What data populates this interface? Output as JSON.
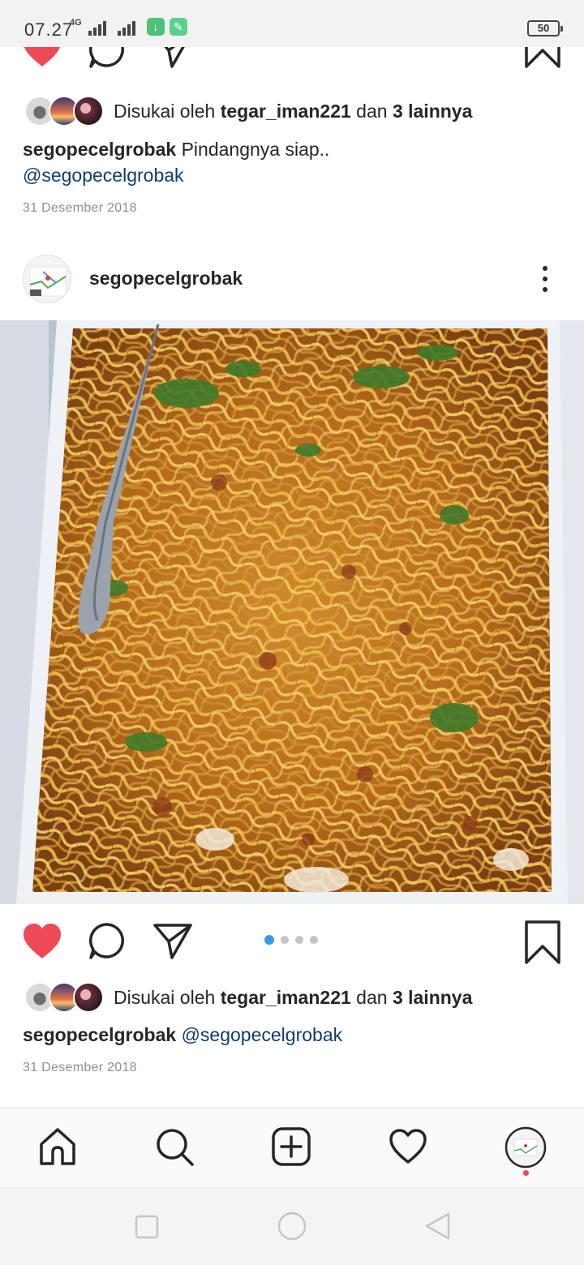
{
  "status_bar": {
    "time": "07.27",
    "network": "4G",
    "battery": "50"
  },
  "post1": {
    "likes_prefix": "Disukai oleh ",
    "likes_user": "tegar_iman221",
    "likes_and": " dan ",
    "likes_others": "3 lainnya",
    "caption_user": "segopecelgrobak",
    "caption_text": " Pindangnya siap..",
    "caption_mention": "@segopecelgrobak",
    "date": "31 Desember 2018"
  },
  "post2": {
    "username": "segopecelgrobak",
    "carousel_count": 4,
    "carousel_active": 1,
    "likes_prefix": "Disukai oleh ",
    "likes_user": "tegar_iman221",
    "likes_and": " dan ",
    "likes_others": "3 lainnya",
    "caption_user": "segopecelgrobak",
    "caption_mention": "@segopecelgrobak",
    "date": "31 Desember 2018"
  },
  "icons": {
    "like": "heart-filled-icon",
    "comment": "comment-bubble-icon",
    "share": "paper-plane-icon",
    "save": "bookmark-icon",
    "more": "vertical-dots-icon",
    "nav": [
      "home-icon",
      "search-icon",
      "add-post-icon",
      "activity-heart-icon",
      "profile-avatar-icon"
    ],
    "system": [
      "recent-apps-icon",
      "home-circle-icon",
      "back-triangle-icon"
    ]
  },
  "colors": {
    "like_red": "#ed4956",
    "mention_blue": "#0f3c6e",
    "carousel_active": "#3897f0",
    "notification_dot": "#ed4956"
  }
}
